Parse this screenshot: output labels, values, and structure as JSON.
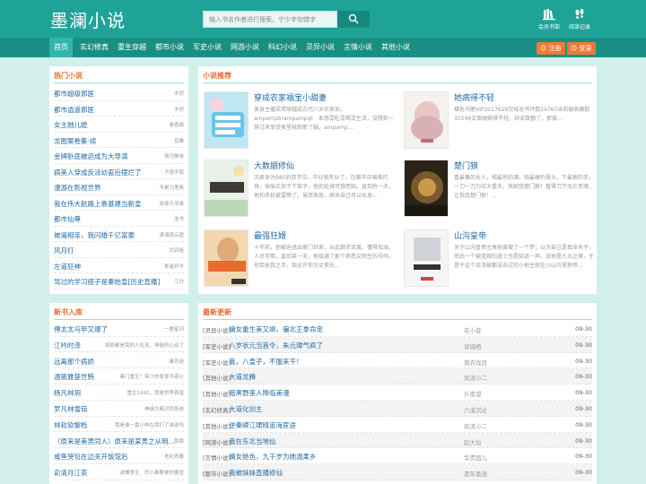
{
  "site": {
    "logo": "墨澜小说"
  },
  "search": {
    "placeholder": "输入书名作者进行搜索，宁少字勿错字"
  },
  "header_links": [
    {
      "label": "会员书架"
    },
    {
      "label": "阅读记录"
    }
  ],
  "nav": {
    "items": [
      {
        "label": "首页",
        "active": true
      },
      {
        "label": "玄幻修真"
      },
      {
        "label": "重生穿越"
      },
      {
        "label": "都市小说"
      },
      {
        "label": "军史小说"
      },
      {
        "label": "网游小说"
      },
      {
        "label": "科幻小说"
      },
      {
        "label": "灵异小说"
      },
      {
        "label": "言情小说"
      },
      {
        "label": "其他小说"
      }
    ],
    "register_label": "注册",
    "login_label": "登录"
  },
  "colors": {
    "brand": "#1fa397",
    "nav": "#198f84",
    "accent": "#f07a36",
    "link": "#1f6aa5"
  },
  "hot": {
    "title": "热门小说",
    "items": [
      {
        "title": "都市超级邪医",
        "author": "木然"
      },
      {
        "title": "都市逍遥邪医",
        "author": "木然"
      },
      {
        "title": "女主她儿媳",
        "author": "看香薇"
      },
      {
        "title": "龙图案卷集·续",
        "author": "耳雅"
      },
      {
        "title": "金牌卧底被迫成为大导演",
        "author": "强马推卷"
      },
      {
        "title": "病美人穿成反派幼崽后摆烂了",
        "author": "子夜不眠"
      },
      {
        "title": "漫游在影视世界",
        "author": "不是马里奥"
      },
      {
        "title": "我在伟大航路上靠基建当新皇",
        "author": "晓夜天寻录"
      },
      {
        "title": "都市仙尊",
        "author": "浩书"
      },
      {
        "title": "被逼相亲，我闪婚千亿富豪",
        "author": "潇湘夜云霆"
      },
      {
        "title": "风月打",
        "author": "尤四姐"
      },
      {
        "title": "左道狂神",
        "author": "爱者好羊"
      },
      {
        "title": "骂过的学习搭子是秦始皇[历史直播]",
        "author": "江白"
      }
    ]
  },
  "recommend": {
    "title": "小说推荐",
    "items": [
      {
        "title": "穿成农家福宝小甜妻",
        "desc": "美食主播梁鸢穿越成古代八岁农家女。ampampbrampampgt　本想混吃混喝混生活，没想到一穿过来享受家里就斩断了腿。ampamp..."
      },
      {
        "title": "她病得不轻",
        "desc": "橘色书屋VIP2017628完结总书评数24763当前被收藏数35549文案她病得不轻，辞去数额了，那被..."
      },
      {
        "title": "大数据修仙",
        "desc": "冯君身为985的双学位，毕业就失业了。在都市中艰难打拼，偷偷正放不下架子，他的处境可想而知。直到有一天，他和手机被雷劈了。虽然发现，原来自己可以化身..."
      },
      {
        "title": "楚门狼",
        "desc": "看最毒的女人，喝最烈的酒。啃最硬的骨头，下最狠的手。一刀一刀力压大重天，快敲我楚门狼！暂得刀下无亡恶魂，让我我楚门狼！..."
      },
      {
        "title": "最强狂婿",
        "desc": "十年前，他被迫逃出家门世家，从此颠沛流离，懂得加油，人尽可欺。直到某一天，他接通了那个熟悉又陌生的号码。你若执我之手，我必许你万丈荣光..."
      },
      {
        "title": "山沟皇帝",
        "desc": "关于山沟皇帝主角他曾做了一个梦，以为自己是真命天子，然后一个被道观的道士也是知道一声。说他是九五之尊，于是于这个流淌被都没去过的小地主就在小山沟里称帝..."
      }
    ]
  },
  "new_books": {
    "title": "新书入库",
    "items": [
      {
        "title": "傅太太马甲又爆了",
        "author": "一鹿星河"
      },
      {
        "title": "江吟时泽",
        "author": "病娇都是我的人在宠，神秘的心动了"
      },
      {
        "title": "远离那个病娇",
        "author": "秦芳迹"
      },
      {
        "title": "温筱雅楚世韩",
        "author": "秦门重生！带少的爹爹不惑火"
      },
      {
        "title": "杨凡林玥",
        "author": "重生1992，我是世界首富"
      },
      {
        "title": "罗凡林雪茹",
        "author": "神级文都对同系统"
      },
      {
        "title": "林软软黎栎",
        "author": "我是谁一盘小林在我们了谁说吗"
      },
      {
        "title": "（原来是美男同人）原来是某男之从明...",
        "author": "慕鼎"
      },
      {
        "title": "咸鱼哭包在边关开饭馆后",
        "author": "老初青藤"
      },
      {
        "title": "俞清月江茶",
        "author": "请兼意生，恐人都要被你要冒"
      }
    ]
  },
  "latest": {
    "title": "最新更新",
    "items": [
      {
        "cat": "[灵异小说]",
        "title": "嫡女重生美又飒，骗北王拿命宠",
        "author": "花小昔",
        "date": "09-30"
      },
      {
        "cat": "[军史小说]",
        "title": "八岁状元当首令，朱元璋气疯了",
        "author": "谈城栖",
        "date": "09-30"
      },
      {
        "cat": "[军史小说]",
        "title": "我，八皇子，不服来干！",
        "author": "南农戏目",
        "date": "09-30"
      },
      {
        "cat": "[其他小说]",
        "title": "大道龙腾",
        "author": "风流小二",
        "date": "09-30"
      },
      {
        "cat": "[其他小说]",
        "title": "暗黑野蛮人降临美漫",
        "author": "斤南望",
        "date": "09-30"
      },
      {
        "cat": "[玄幻修真]",
        "title": "大道化剑主",
        "author": "六道沉沦",
        "date": "09-30"
      },
      {
        "cat": "[其他小说]",
        "title": "逆秦嵘江啸晴宙海宦途",
        "author": "风流小二",
        "date": "09-30"
      },
      {
        "cat": "[网游小说]",
        "title": "我在东北当地仙",
        "author": "赵大仙",
        "date": "09-30"
      },
      {
        "cat": "[言情小说]",
        "title": "嫡女绝色，九千岁为她温柔乡",
        "author": "华贵固儿",
        "date": "09-30"
      },
      {
        "cat": "[都市小说]",
        "title": "我被妹妹直播修仙",
        "author": "遗年葛逍",
        "date": "09-30"
      }
    ]
  }
}
